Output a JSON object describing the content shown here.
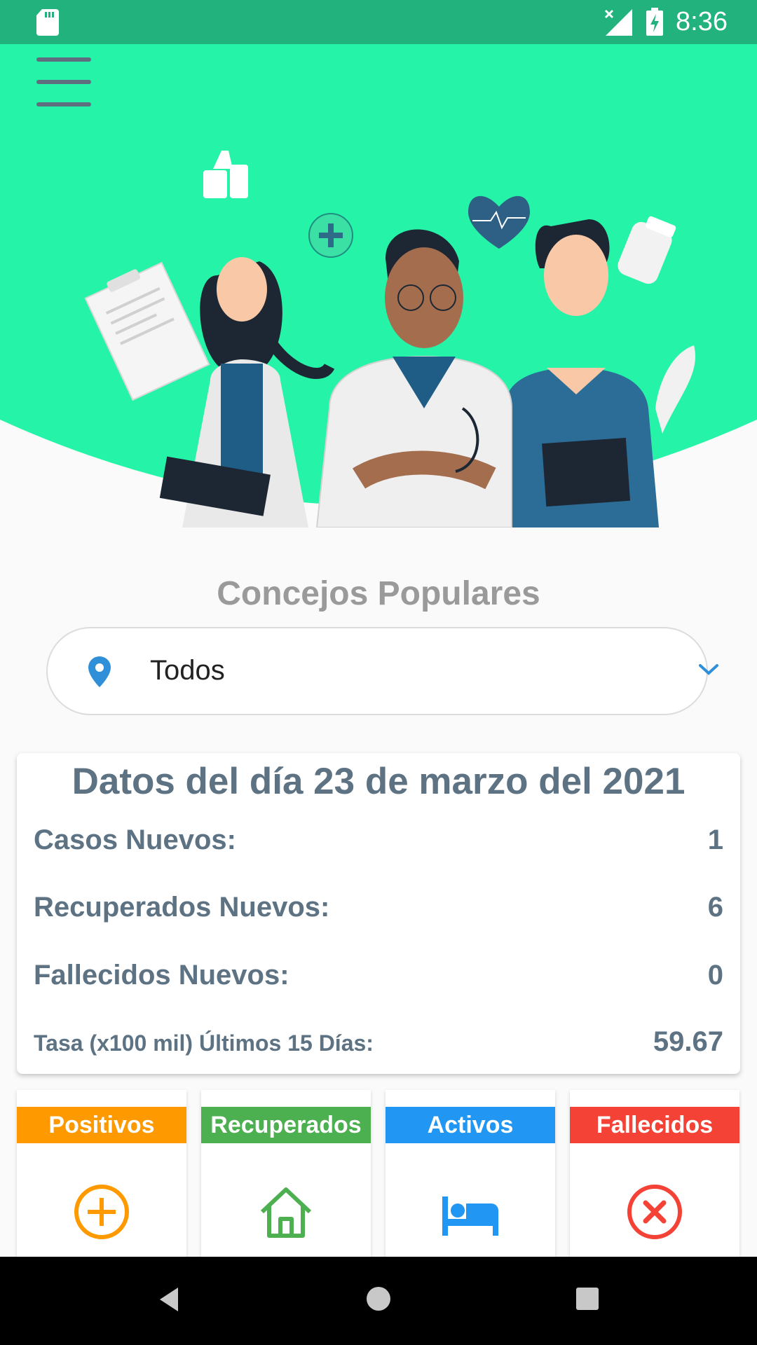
{
  "status_bar": {
    "time": "8:36",
    "icons": [
      "sd-card-icon",
      "signal-off-icon",
      "battery-charging-icon"
    ]
  },
  "hero": {
    "background_color": "#25f4a8",
    "illustration": "three-doctors-illustration"
  },
  "section_title": "Concejos Populares",
  "location_select": {
    "value": "Todos",
    "icon": "location-pin-icon",
    "accent": "#2f8fd8"
  },
  "daily_card": {
    "title": "Datos del día 23 de marzo del 2021",
    "rows": [
      {
        "label": "Casos Nuevos:",
        "value": "1"
      },
      {
        "label": "Recuperados Nuevos:",
        "value": "6"
      },
      {
        "label": "Fallecidos Nuevos:",
        "value": "0"
      }
    ],
    "rate": {
      "label": "Tasa (x100 mil) Últimos 15 Días:",
      "value": "59.67"
    }
  },
  "tiles": [
    {
      "label": "Positivos",
      "color": "#fe9a00",
      "icon": "plus-circle-icon"
    },
    {
      "label": "Recuperados",
      "color": "#4caf50",
      "icon": "home-icon"
    },
    {
      "label": "Activos",
      "color": "#2196f3",
      "icon": "bed-icon"
    },
    {
      "label": "Fallecidos",
      "color": "#f44336",
      "icon": "close-circle-icon"
    }
  ]
}
